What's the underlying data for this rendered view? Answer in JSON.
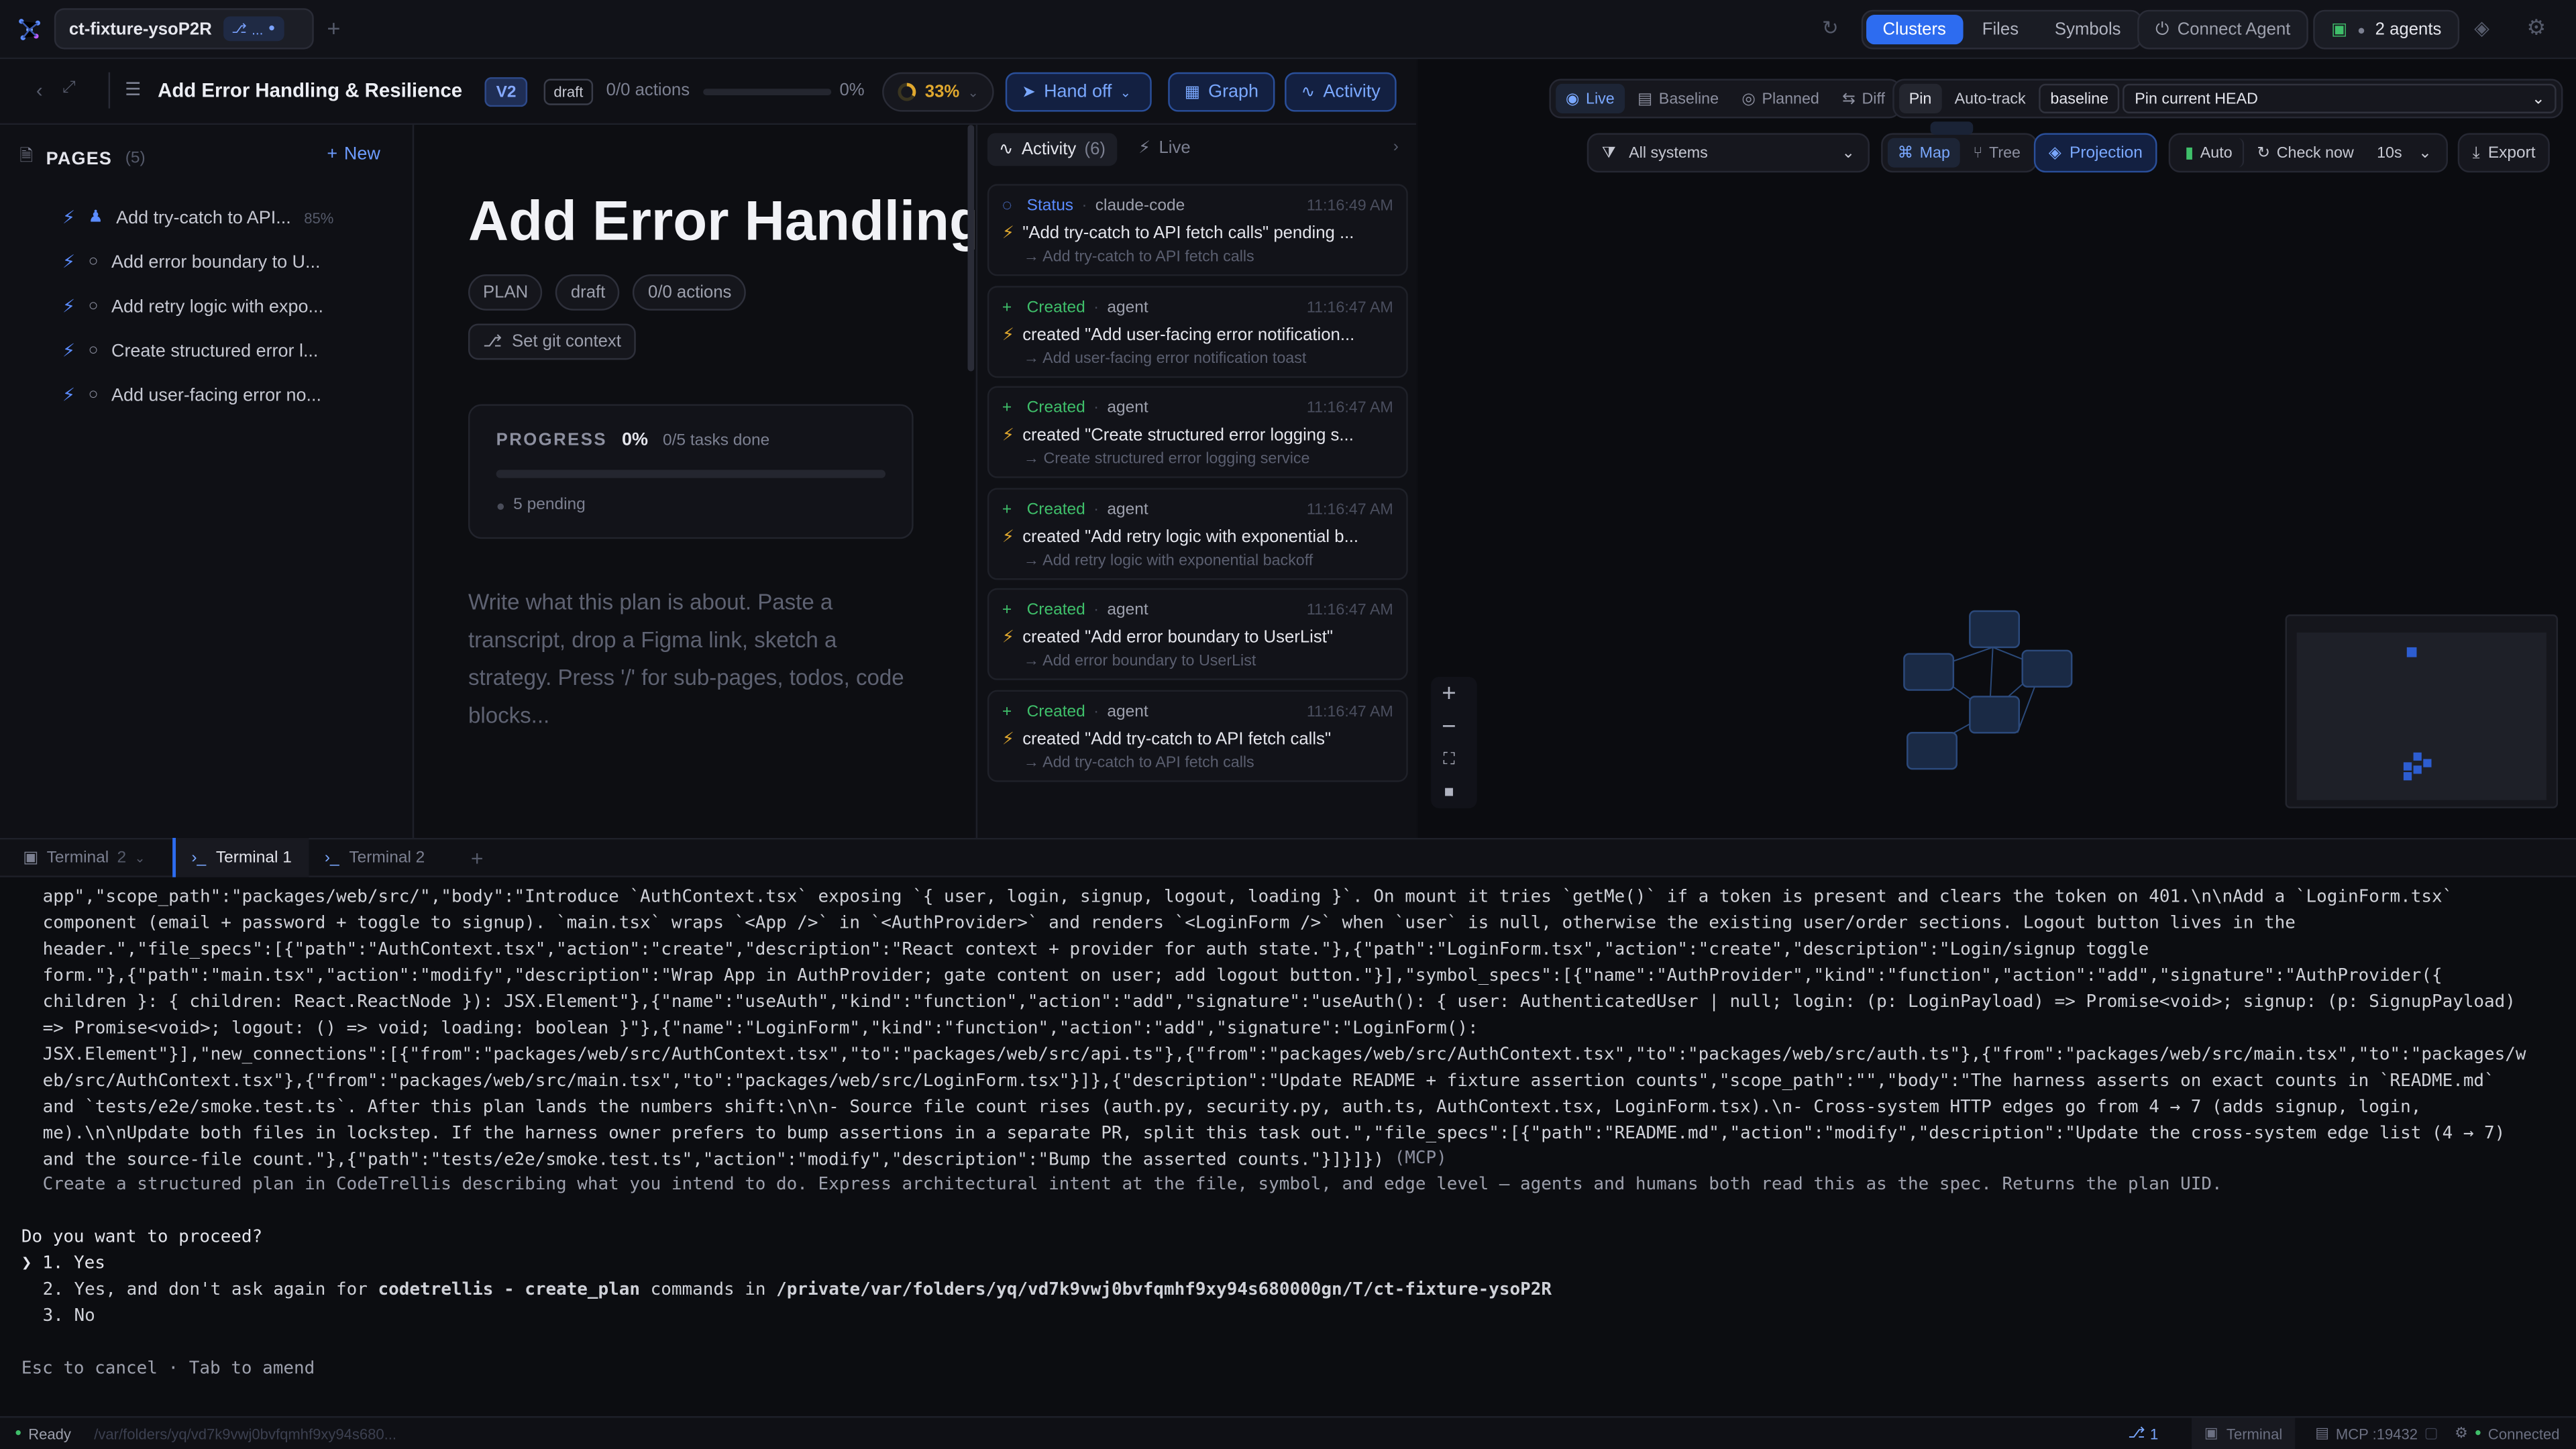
{
  "titlebar": {
    "tab_name": "ct-fixture-ysoP2R",
    "tab_branch": "...",
    "nav": [
      "Clusters",
      "Files",
      "Symbols"
    ],
    "connect_agent": "Connect Agent",
    "agents": "2 agents"
  },
  "doc_header": {
    "title": "Add Error Handling & Resilience",
    "version": "V2",
    "status": "draft",
    "actions": "0/0 actions",
    "percent": "0%",
    "progress_fraction": 0,
    "ring_percent": "33%",
    "hand_off": "Hand off",
    "graph": "Graph",
    "activity": "Activity"
  },
  "pages": {
    "heading": "PAGES",
    "count": "(5)",
    "new_label": "New",
    "items": [
      {
        "label": "Add try-catch to API...",
        "meta": "85%",
        "assigned": true
      },
      {
        "label": "Add error boundary to U..."
      },
      {
        "label": "Add retry logic with expo..."
      },
      {
        "label": "Create structured error l..."
      },
      {
        "label": "Add user-facing error no..."
      }
    ]
  },
  "editor": {
    "title": "Add Error Handling",
    "chips": [
      "PLAN",
      "draft",
      "0/0 actions"
    ],
    "git_context": "Set git context",
    "progress_label": "PROGRESS",
    "progress_pct": "0%",
    "progress_tasks": "0/5 tasks done",
    "pending": "5 pending",
    "placeholder": "Write what this plan is about. Paste a transcript, drop a Figma link, sketch a strategy. Press '/' for sub-pages, todos, code blocks..."
  },
  "activity": {
    "tab_activity": "Activity",
    "tab_count": "(6)",
    "tab_live": "Live",
    "items": [
      {
        "kind": "Status",
        "actor": "claude-code",
        "time": "11:16:49 AM",
        "text": "\"Add try-catch to API fetch calls\" pending ...",
        "sub": "→ Add try-catch to API fetch calls"
      },
      {
        "kind": "Created",
        "actor": "agent",
        "time": "11:16:47 AM",
        "text": "created \"Add user-facing error notification...",
        "sub": "→ Add user-facing error notification toast"
      },
      {
        "kind": "Created",
        "actor": "agent",
        "time": "11:16:47 AM",
        "text": "created \"Create structured error logging s...",
        "sub": "→ Create structured error logging service"
      },
      {
        "kind": "Created",
        "actor": "agent",
        "time": "11:16:47 AM",
        "text": "created \"Add retry logic with exponential b...",
        "sub": "→ Add retry logic with exponential backoff"
      },
      {
        "kind": "Created",
        "actor": "agent",
        "time": "11:16:47 AM",
        "text": "created \"Add error boundary to UserList\"",
        "sub": "→ Add error boundary to UserList"
      },
      {
        "kind": "Created",
        "actor": "agent",
        "time": "11:16:47 AM",
        "text": "created \"Add try-catch to API fetch calls\"",
        "sub": "→ Add try-catch to API fetch calls"
      }
    ]
  },
  "graph": {
    "modes": [
      "Live",
      "Baseline",
      "Planned",
      "Diff"
    ],
    "pin": "Pin",
    "auto_track": "Auto-track",
    "baseline": "baseline",
    "pin_select": "Pin current HEAD",
    "systems": "All systems",
    "map": "Map",
    "tree": "Tree",
    "projection": "Projection",
    "auto": "Auto",
    "check_now": "Check now",
    "interval": "10s",
    "export": "Export"
  },
  "terminal": {
    "group_label": "Terminal",
    "group_count": "2",
    "tabs": [
      "Terminal 1",
      "Terminal 2"
    ],
    "lines": [
      "app\",\"scope_path\":\"packages/web/src/\",\"body\":\"Introduce `AuthContext.tsx` exposing `{ user, login, signup, logout, loading }`. On mount it tries `getMe()` if a token is present and clears the token on 401.\\n\\nAdd a `LoginForm.tsx`",
      "component (email + password + toggle to signup). `main.tsx` wraps `<App />` in `<AuthProvider>` and renders `<LoginForm />` when `user` is null, otherwise the existing user/order sections. Logout button lives in the",
      "header.\",\"file_specs\":[{\"path\":\"AuthContext.tsx\",\"action\":\"create\",\"description\":\"React context + provider for auth state.\"},{\"path\":\"LoginForm.tsx\",\"action\":\"create\",\"description\":\"Login/signup toggle",
      "form.\"},{\"path\":\"main.tsx\",\"action\":\"modify\",\"description\":\"Wrap App in AuthProvider; gate content on user; add logout button.\"}],\"symbol_specs\":[{\"name\":\"AuthProvider\",\"kind\":\"function\",\"action\":\"add\",\"signature\":\"AuthProvider({",
      "children }: { children: React.ReactNode }): JSX.Element\"},{\"name\":\"useAuth\",\"kind\":\"function\",\"action\":\"add\",\"signature\":\"useAuth(): { user: AuthenticatedUser | null; login: (p: LoginPayload) => Promise<void>; signup: (p: SignupPayload)",
      "=> Promise<void>; logout: () => void; loading: boolean }\"},{\"name\":\"LoginForm\",\"kind\":\"function\",\"action\":\"add\",\"signature\":\"LoginForm():",
      "JSX.Element\"}],\"new_connections\":[{\"from\":\"packages/web/src/AuthContext.tsx\",\"to\":\"packages/web/src/api.ts\"},{\"from\":\"packages/web/src/AuthContext.tsx\",\"to\":\"packages/web/src/auth.ts\"},{\"from\":\"packages/web/src/main.tsx\",\"to\":\"packages/w",
      "eb/src/AuthContext.tsx\"},{\"from\":\"packages/web/src/main.tsx\",\"to\":\"packages/web/src/LoginForm.tsx\"}]},{\"description\":\"Update README + fixture assertion counts\",\"scope_path\":\"\",\"body\":\"The harness asserts on exact counts in `README.md`",
      "and `tests/e2e/smoke.test.ts`. After this plan lands the numbers shift:\\n\\n- Source file count rises (auth.py, security.py, auth.ts, AuthContext.tsx, LoginForm.tsx).\\n- Cross-system HTTP edges go from 4 → 7 (adds signup, login,",
      "me).\\n\\nUpdate both files in lockstep. If the harness owner prefers to bump assertions in a separate PR, split this task out.\",\"file_specs\":[{\"path\":\"README.md\",\"action\":\"modify\",\"description\":\"Update the cross-system edge list (4 → 7)",
      "and the source-file count.\"},{\"path\":\"tests/e2e/smoke.test.ts\",\"action\":\"modify\",\"description\":\"Bump the asserted counts.\"}]}]})"
    ],
    "mcp_tag": "(MCP)",
    "tool_desc": "Create a structured plan in CodeTrellis describing what you intend to do. Express architectural intent at the file, symbol, and edge level — agents and humans both read this as the spec. Returns the plan UID.",
    "question": "Do you want to proceed?",
    "opt1": "1. Yes",
    "opt2_prefix": "2. Yes, and don't ask again for ",
    "opt2_cmd": "codetrellis - create_plan",
    "opt2_mid": " commands in ",
    "opt2_path": "/private/var/folders/yq/vd7k9vwj0bvfqmhf9xy94s680000gn/T/ct-fixture-ysoP2R",
    "opt3": "3. No",
    "footer": "Esc to cancel · Tab to amend"
  },
  "statusbar": {
    "ready": "Ready",
    "path": "/var/folders/yq/vd7k9vwj0bvfqmhf9xy94s680...",
    "branch_count": "1",
    "terminal": "Terminal",
    "mcp": "MCP :19432",
    "connected": "Connected"
  },
  "colors": {
    "accent": "#2d6cf0",
    "created": "#3fbf6a",
    "status": "#5b8cff",
    "bolt": "#e0a82e",
    "ring": "#e0a82e"
  }
}
